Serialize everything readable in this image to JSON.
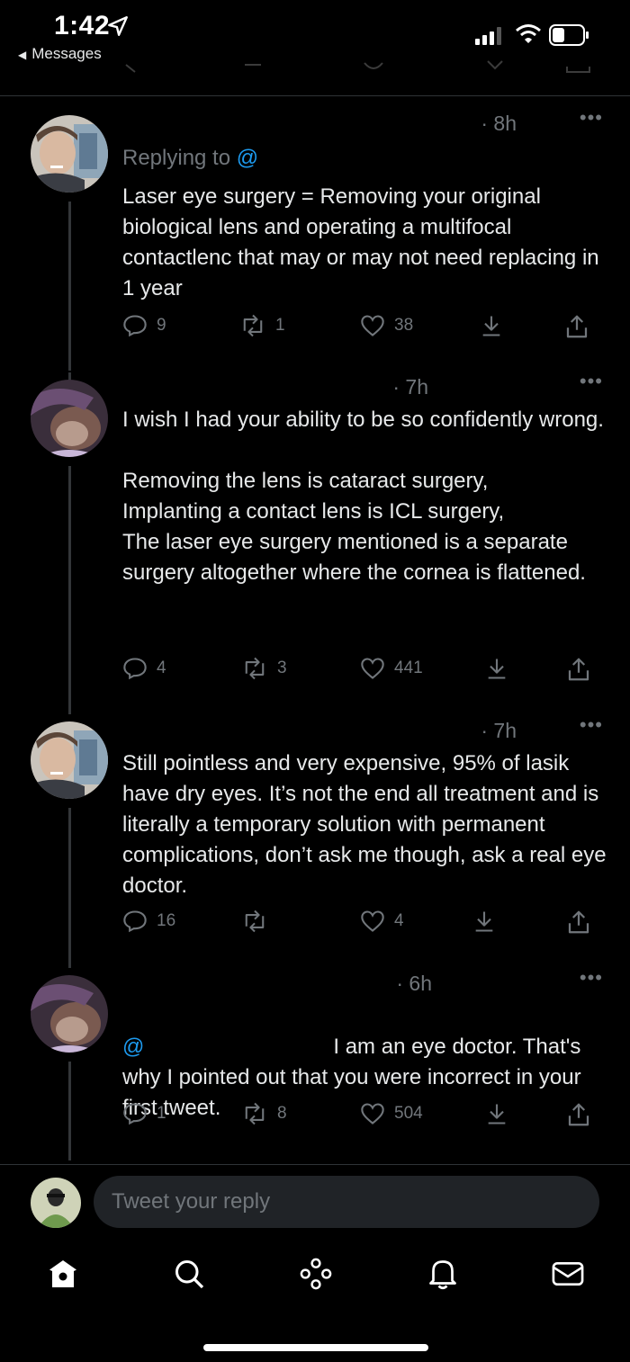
{
  "status_bar": {
    "time": "1:42",
    "back_label": "Messages"
  },
  "tweets": [
    {
      "timestamp": "· 8h",
      "more": "•••",
      "replying_label": "Replying to",
      "replying_mention": "@",
      "text": "Laser eye surgery = Removing your original biological lens and operating a multifocal contactlenc that may or may not need replacing in 1 year",
      "replies": "9",
      "retweets": "1",
      "likes": "38"
    },
    {
      "timestamp": "· 7h",
      "more": "•••",
      "text": "I wish I had your ability to be so confidently wrong.\n\nRemoving the lens is cataract surgery,\nImplanting a contact lens is ICL surgery,\nThe laser eye surgery mentioned is a separate surgery altogether where the cornea is flattened.",
      "replies": "4",
      "retweets": "3",
      "likes": "441"
    },
    {
      "timestamp": "· 7h",
      "more": "•••",
      "text": "Still pointless and very expensive, 95% of lasik have dry eyes. It’s not the end all treatment and is literally a temporary solution with permanent complications, don’t ask me though, ask a real eye doctor.",
      "replies": "16",
      "retweets": "",
      "likes": "4"
    },
    {
      "timestamp": "· 6h",
      "more": "•••",
      "mention": "@",
      "text": "I am an eye doctor. That's why I pointed out that you were incorrect in your first tweet.",
      "replies": "1",
      "retweets": "8",
      "likes": "504"
    }
  ],
  "compose": {
    "placeholder": "Tweet your reply"
  },
  "tabs": [
    "home-icon",
    "search-icon",
    "spaces-icon",
    "notifications-icon",
    "messages-icon"
  ],
  "colors": {
    "background": "#000000",
    "text": "#e7e9ea",
    "muted": "#71767b",
    "accent": "#1d9bf0",
    "field": "#202327"
  }
}
